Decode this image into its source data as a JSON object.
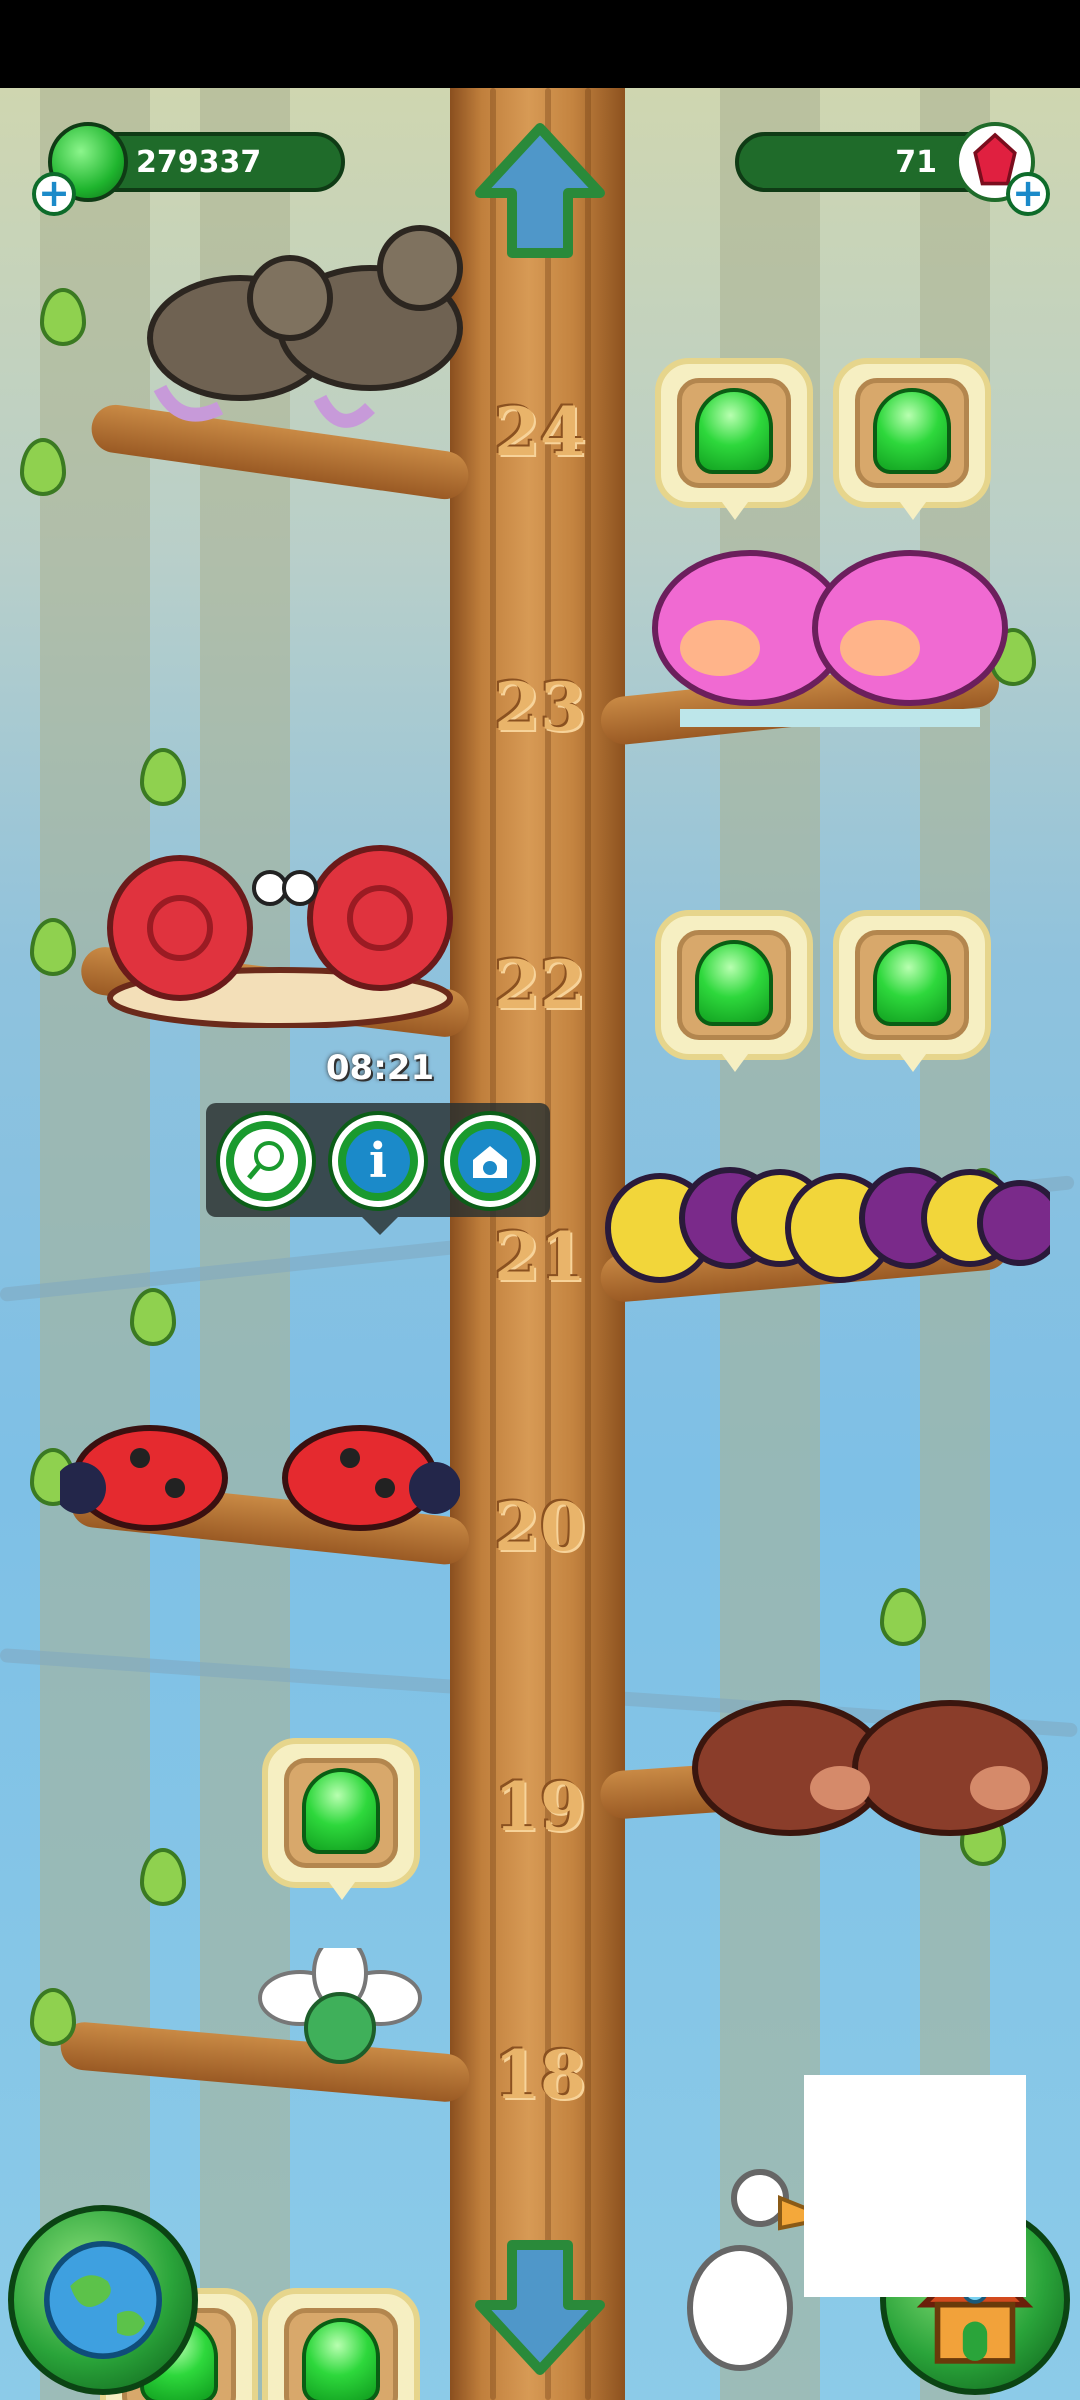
{
  "hud": {
    "coins_value": "279337",
    "gems_value": "71",
    "coin_icon": "green-jelly-icon",
    "gem_icon": "red-crystal-icon",
    "add_icon": "plus-icon"
  },
  "tree": {
    "floor_numbers": [
      "24",
      "23",
      "22",
      "21",
      "20",
      "19",
      "18"
    ]
  },
  "popup": {
    "timer": "08:21",
    "buttons": [
      {
        "name": "catch-net-icon"
      },
      {
        "name": "info-icon"
      },
      {
        "name": "pet-house-icon"
      }
    ]
  },
  "colors": {
    "trunk": "#c07f3c",
    "hud_green": "#1f6b2a",
    "jelly_green": "#2ed83c",
    "bubble_cream": "#f6efc2"
  },
  "navigation": {
    "up_icon": "arrow-up-icon",
    "down_icon": "arrow-down-icon",
    "map_icon": "globe-icon",
    "home_icon": "house-icon"
  }
}
